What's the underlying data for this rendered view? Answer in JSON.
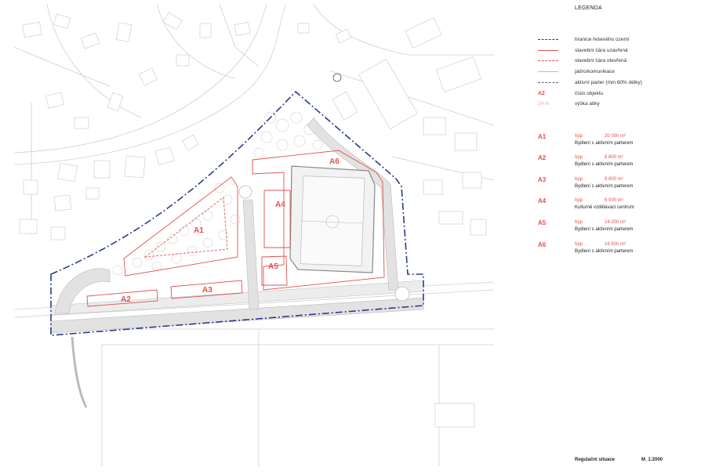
{
  "legend": {
    "title": "LEGENDA",
    "items": [
      {
        "symbol": "dash-dot-blue",
        "label": "hranice řešeného území"
      },
      {
        "symbol": "solid-red",
        "label": "stavební čára uzavřená"
      },
      {
        "symbol": "dashed-red",
        "label": "stavební čára otevřená"
      },
      {
        "symbol": "thin-pink",
        "label": "jádro/komunikace"
      },
      {
        "symbol": "dashed-gray",
        "label": "aktivní parter (min 60% délky)"
      },
      {
        "symbol": "code",
        "code": "A2",
        "label": "číslo objektu"
      },
      {
        "symbol": "height",
        "code": "24 m",
        "label": "výška atiky"
      }
    ]
  },
  "objects": [
    {
      "code": "A1",
      "hpp_label": "hpp",
      "area": "20 000 m²",
      "use": "Bydlení s aktivním parterem"
    },
    {
      "code": "A2",
      "hpp_label": "hpp",
      "area": "8 800 m²",
      "use": "Bydlení s aktivním parterem"
    },
    {
      "code": "A3",
      "hpp_label": "hpp",
      "area": "9 800 m²",
      "use": "Bydlení s aktivním parterem"
    },
    {
      "code": "A4",
      "hpp_label": "hpp",
      "area": "6 000 m²",
      "use": "Kulturně vzdělávací centrum"
    },
    {
      "code": "A5",
      "hpp_label": "hpp",
      "area": "24 000 m²",
      "use": "Bydlení s aktivním parterem"
    },
    {
      "code": "A6",
      "hpp_label": "hpp",
      "area": "16 500 m²",
      "use": "Bydlení s aktivním parterem"
    }
  ],
  "map_labels": {
    "a1": "A1",
    "a2": "A2",
    "a3": "A3",
    "a4": "A4",
    "a5": "A5",
    "a6": "A6"
  },
  "footer": {
    "title": "Regulační situace",
    "scale": "M_1:2000"
  },
  "colors": {
    "boundary": "#2c3a8f",
    "building_line": "#e0524f",
    "context": "#c9c9c9",
    "road": "#d6d6d6"
  }
}
